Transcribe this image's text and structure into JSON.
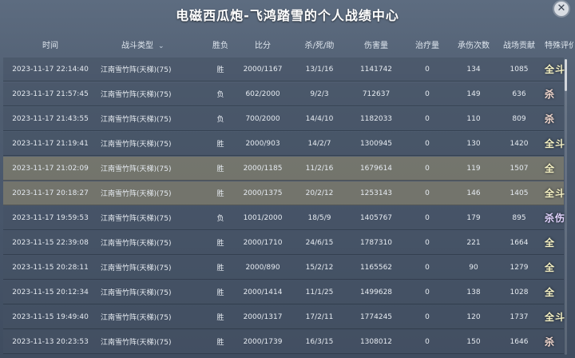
{
  "title": "电磁西瓜炮-飞鸿踏雪的个人战绩中心",
  "close_label": "✕",
  "headers": {
    "time": "时间",
    "type": "战斗类型",
    "result": "胜负",
    "score": "比分",
    "kda": "杀/死/助",
    "damage": "伤害量",
    "heal": "治疗量",
    "tank": "承伤次数",
    "contrib": "战场贡献",
    "eval": "特殊评价"
  },
  "sort_icon": "chevron-down-icon",
  "rows": [
    {
      "time": "2023-11-17 22:14:40",
      "type": "江南雪竹阵(天梯)(75)",
      "result": "胜",
      "score": "2000/1167",
      "kda": "13/1/16",
      "damage": "1141742",
      "heal": "0",
      "tank": "134",
      "contrib": "1085",
      "eval": "全斗",
      "hl": false
    },
    {
      "time": "2023-11-17 21:57:45",
      "type": "江南雪竹阵(天梯)(75)",
      "result": "负",
      "score": "602/2000",
      "kda": "9/2/3",
      "damage": "712637",
      "heal": "0",
      "tank": "149",
      "contrib": "636",
      "eval": "杀",
      "hl": false
    },
    {
      "time": "2023-11-17 21:43:55",
      "type": "江南雪竹阵(天梯)(75)",
      "result": "负",
      "score": "700/2000",
      "kda": "14/4/10",
      "damage": "1182033",
      "heal": "0",
      "tank": "110",
      "contrib": "809",
      "eval": "杀",
      "hl": false
    },
    {
      "time": "2023-11-17 21:19:41",
      "type": "江南雪竹阵(天梯)(75)",
      "result": "胜",
      "score": "2000/903",
      "kda": "14/2/7",
      "damage": "1300945",
      "heal": "0",
      "tank": "130",
      "contrib": "1420",
      "eval": "全斗",
      "hl": false
    },
    {
      "time": "2023-11-17 21:02:09",
      "type": "江南雪竹阵(天梯)(75)",
      "result": "胜",
      "score": "2000/1185",
      "kda": "11/2/16",
      "damage": "1679614",
      "heal": "0",
      "tank": "119",
      "contrib": "1507",
      "eval": "全",
      "hl": true
    },
    {
      "time": "2023-11-17 20:18:27",
      "type": "江南雪竹阵(天梯)(75)",
      "result": "胜",
      "score": "2000/1375",
      "kda": "20/2/12",
      "damage": "1253143",
      "heal": "0",
      "tank": "146",
      "contrib": "1405",
      "eval": "全斗",
      "hl": true
    },
    {
      "time": "2023-11-17 19:59:53",
      "type": "江南雪竹阵(天梯)(75)",
      "result": "负",
      "score": "1001/2000",
      "kda": "18/5/9",
      "damage": "1405767",
      "heal": "0",
      "tank": "179",
      "contrib": "895",
      "eval": "杀伤",
      "hl": false
    },
    {
      "time": "2023-11-15 22:39:08",
      "type": "江南雪竹阵(天梯)(75)",
      "result": "胜",
      "score": "2000/1710",
      "kda": "24/6/15",
      "damage": "1787310",
      "heal": "0",
      "tank": "221",
      "contrib": "1664",
      "eval": "全",
      "hl": false
    },
    {
      "time": "2023-11-15 20:28:11",
      "type": "江南雪竹阵(天梯)(75)",
      "result": "胜",
      "score": "2000/890",
      "kda": "15/2/12",
      "damage": "1165562",
      "heal": "0",
      "tank": "90",
      "contrib": "1279",
      "eval": "全",
      "hl": false
    },
    {
      "time": "2023-11-15 20:12:34",
      "type": "江南雪竹阵(天梯)(75)",
      "result": "胜",
      "score": "2000/1414",
      "kda": "11/1/25",
      "damage": "1499628",
      "heal": "0",
      "tank": "138",
      "contrib": "1028",
      "eval": "全",
      "hl": false
    },
    {
      "time": "2023-11-15 19:49:40",
      "type": "江南雪竹阵(天梯)(75)",
      "result": "胜",
      "score": "2000/1317",
      "kda": "17/2/11",
      "damage": "1774245",
      "heal": "0",
      "tank": "120",
      "contrib": "1737",
      "eval": "全斗",
      "hl": false
    },
    {
      "time": "2023-11-13 20:23:53",
      "type": "江南雪竹阵(天梯)(75)",
      "result": "胜",
      "score": "2000/1739",
      "kda": "16/3/15",
      "damage": "1308012",
      "heal": "0",
      "tank": "150",
      "contrib": "1646",
      "eval": "杀",
      "hl": false
    }
  ]
}
